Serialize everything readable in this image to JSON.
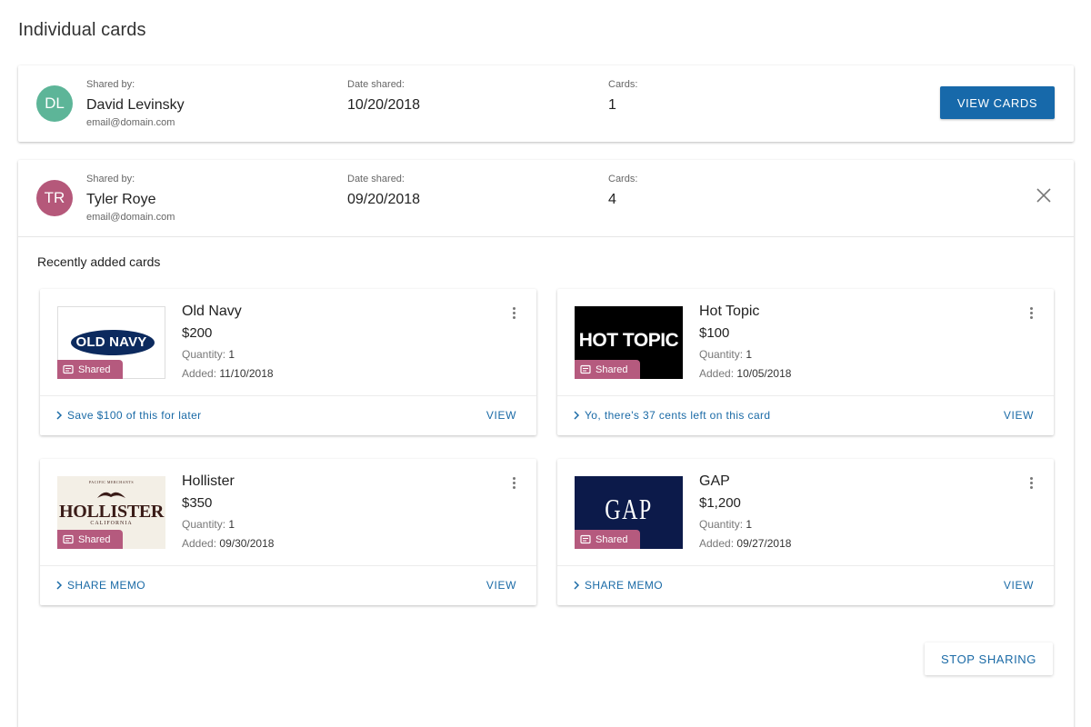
{
  "page": {
    "title": "Individual cards"
  },
  "shares": [
    {
      "initials": "DL",
      "avatar_color": "#5db598",
      "shared_by_label": "Shared by:",
      "name": "David Levinsky",
      "email": "email@domain.com",
      "date_label": "Date shared:",
      "date": "10/20/2018",
      "cards_label": "Cards:",
      "cards_count": "1",
      "view_cards_label": "VIEW CARDS"
    },
    {
      "initials": "TR",
      "avatar_color": "#b5587a",
      "shared_by_label": "Shared by:",
      "name": "Tyler Roye",
      "email": "email@domain.com",
      "date_label": "Date shared:",
      "date": "09/20/2018",
      "cards_label": "Cards:",
      "cards_count": "4",
      "close_icon": "close-icon",
      "recent_title": "Recently added cards",
      "stop_sharing_label": "STOP SHARING",
      "gift_cards": [
        {
          "brand": "Old Navy",
          "logo_text": "OLD NAVY",
          "amount": "$200",
          "qty_label": "Quantity:",
          "qty": "1",
          "added_label": "Added:",
          "added": "11/10/2018",
          "badge": "Shared",
          "action": "Save $100 of this for later",
          "view": "VIEW"
        },
        {
          "brand": "Hot Topic",
          "logo_text": "HOT TOPIC",
          "amount": "$100",
          "qty_label": "Quantity:",
          "qty": "1",
          "added_label": "Added:",
          "added": "10/05/2018",
          "badge": "Shared",
          "action": "Yo, there's 37 cents left on this card",
          "view": "VIEW"
        },
        {
          "brand": "Hollister",
          "logo_text": "HOLLISTER",
          "logo_top": "PACIFIC MERCHANTS",
          "logo_bottom": "CALIFORNIA",
          "amount": "$350",
          "qty_label": "Quantity:",
          "qty": "1",
          "added_label": "Added:",
          "added": "09/30/2018",
          "badge": "Shared",
          "action": "SHARE MEMO",
          "view": "VIEW"
        },
        {
          "brand": "GAP",
          "logo_text": "GAP",
          "amount": "$1,200",
          "qty_label": "Quantity:",
          "qty": "1",
          "added_label": "Added:",
          "added": "09/27/2018",
          "badge": "Shared",
          "action": "SHARE MEMO",
          "view": "VIEW"
        }
      ]
    }
  ],
  "colors": {
    "accent": "#1769aa",
    "badge": "#b55a7e",
    "link": "#1a6aa6"
  }
}
